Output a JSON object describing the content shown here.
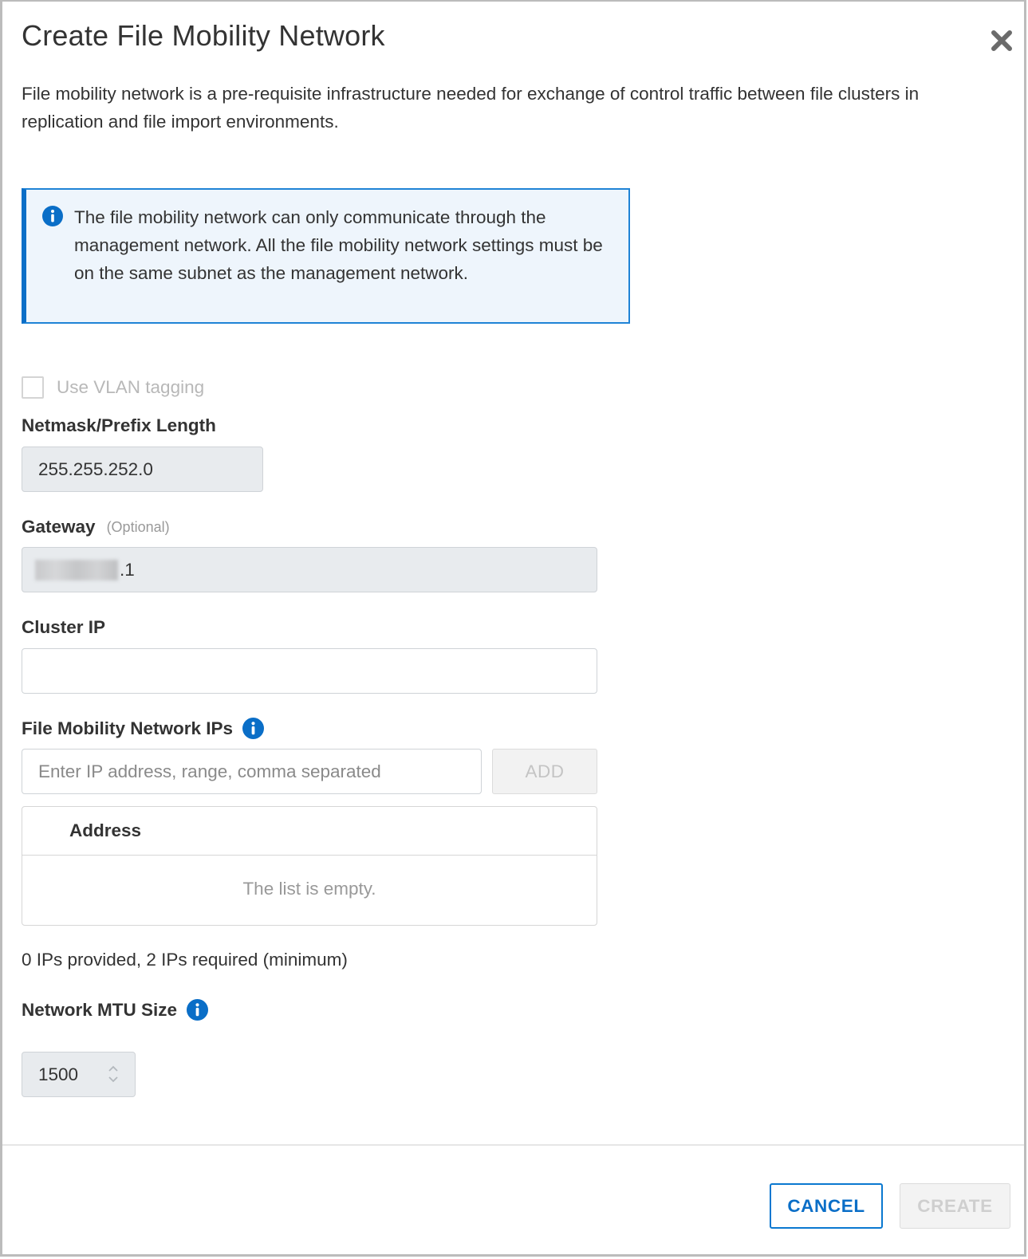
{
  "dialog": {
    "title": "Create File Mobility Network",
    "close_icon": "close-icon",
    "description": "File mobility network is a pre-requisite infrastructure needed for exchange of control traffic between file clusters in replication and file import environments."
  },
  "alert": {
    "icon": "info-icon",
    "text": "The file mobility network can only communicate through the management network. All the file mobility network settings must be on the same subnet as the management network."
  },
  "vlan": {
    "label": "Use VLAN tagging",
    "checked": false,
    "disabled": true
  },
  "netmask": {
    "label": "Netmask/Prefix Length",
    "value": "255.255.252.0"
  },
  "gateway": {
    "label": "Gateway",
    "optional_label": "(Optional)",
    "value_suffix": ".1",
    "value_redacted": true
  },
  "cluster_ip": {
    "label": "Cluster IP",
    "value": ""
  },
  "mobility_ips": {
    "label": "File Mobility Network IPs",
    "info_icon": "info-icon",
    "placeholder": "Enter IP address, range, comma separated",
    "add_label": "ADD",
    "table": {
      "columns": [
        "Address"
      ],
      "rows": [],
      "empty_text": "The list is empty."
    },
    "count_text": "0 IPs provided, 2 IPs required (minimum)"
  },
  "mtu": {
    "label": "Network MTU Size",
    "info_icon": "info-icon",
    "value": "1500"
  },
  "footer": {
    "cancel_label": "CANCEL",
    "create_label": "CREATE"
  },
  "colors": {
    "accent": "#0a6ec7",
    "alert_bg": "#eef5fc",
    "readonly_bg": "#e8ebee"
  }
}
